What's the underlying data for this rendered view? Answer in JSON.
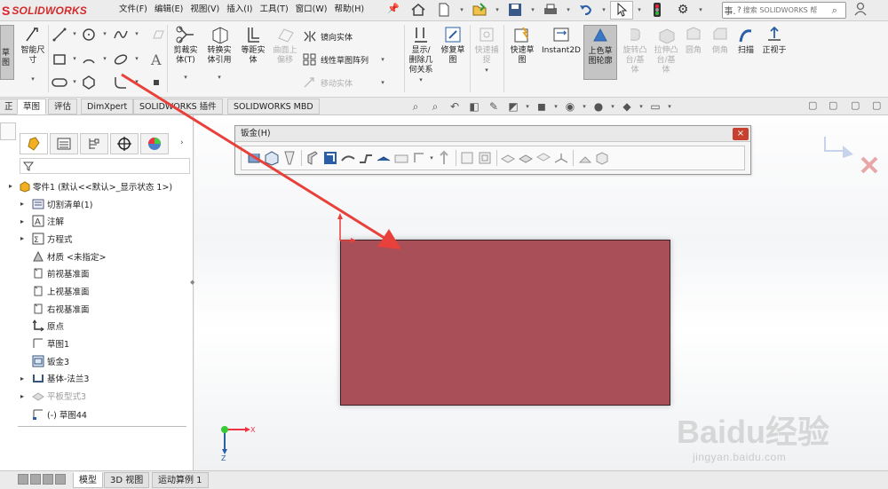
{
  "app": {
    "brand_mark": "S",
    "brand_name": "SOLIDWORKS"
  },
  "menu": [
    "文件(F)",
    "编辑(E)",
    "视图(V)",
    "插入(I)",
    "工具(T)",
    "窗口(W)",
    "帮助(H)"
  ],
  "quick_access": [
    "home-icon",
    "new-icon",
    "open-icon",
    "save-icon",
    "print-icon",
    "undo-icon",
    "select-icon",
    "traffic-light-icon",
    "options-icon"
  ],
  "search": {
    "prefix": "事.",
    "placeholder": "搜索 SOLIDWORKS 帮"
  },
  "command_manager": {
    "big_buttons": [
      {
        "label": "智能尺\n寸",
        "enabled": true
      },
      {
        "label": "剪裁实\n体(T)",
        "enabled": true
      },
      {
        "label": "转换实\n体引用",
        "enabled": true
      },
      {
        "label": "等距实\n体",
        "enabled": true
      },
      {
        "label": "曲面上\n偏移",
        "enabled": false
      },
      {
        "label": "显示/\n删除几\n何关系",
        "enabled": true
      },
      {
        "label": "修复草\n图",
        "enabled": true
      },
      {
        "label": "快速捕\n捉",
        "enabled": false
      },
      {
        "label": "快速草\n图",
        "enabled": true
      },
      {
        "label": "Instant2D",
        "enabled": true
      },
      {
        "label": "上色草\n图轮廓",
        "enabled": true,
        "active": true
      },
      {
        "label": "旋转凸\n台/基\n体",
        "enabled": false
      },
      {
        "label": "拉伸凸\n台/基\n体",
        "enabled": false
      },
      {
        "label": "圆角",
        "enabled": false
      },
      {
        "label": "倒角",
        "enabled": false
      },
      {
        "label": "扫描",
        "enabled": true
      },
      {
        "label": "正视于",
        "enabled": true
      }
    ],
    "small_buttons": [
      {
        "label": "镜向实体",
        "enabled": true
      },
      {
        "label": "线性草图阵列",
        "enabled": true
      },
      {
        "label": "移动实体",
        "enabled": false
      }
    ],
    "partial_left_label": "草\n图"
  },
  "tabs": [
    {
      "label": "正",
      "active": false
    },
    {
      "label": "草图",
      "active": true
    },
    {
      "label": "评估",
      "active": false
    },
    {
      "label": "DimXpert",
      "active": false
    },
    {
      "label": "SOLIDWORKS 插件",
      "active": false
    },
    {
      "label": "SOLIDWORKS MBD",
      "active": false
    }
  ],
  "feature_tree": [
    {
      "label": "零件1 (默认<<默认>_显示状态 1>)",
      "icon": "part-icon",
      "expand": "▸",
      "root": true
    },
    {
      "label": "切割清单(1)",
      "icon": "cut-list-icon",
      "expand": "▸"
    },
    {
      "label": "注解",
      "icon": "annotations-icon",
      "expand": "▸"
    },
    {
      "label": "方程式",
      "icon": "equations-icon",
      "expand": "▸"
    },
    {
      "label": "材质 <未指定>",
      "icon": "material-icon",
      "expand": ""
    },
    {
      "label": "前视基准面",
      "icon": "plane-icon",
      "expand": ""
    },
    {
      "label": "上视基准面",
      "icon": "plane-icon",
      "expand": ""
    },
    {
      "label": "右视基准面",
      "icon": "plane-icon",
      "expand": ""
    },
    {
      "label": "原点",
      "icon": "origin-icon",
      "expand": ""
    },
    {
      "label": "草图1",
      "icon": "sketch-icon",
      "expand": ""
    },
    {
      "label": "钣金3",
      "icon": "sheetmetal-icon",
      "expand": ""
    },
    {
      "label": "基体-法兰3",
      "icon": "base-flange-icon",
      "expand": "▸"
    },
    {
      "label": "平板型式3",
      "icon": "flat-pattern-icon",
      "expand": "▸",
      "disabled": true
    },
    {
      "label": "(-) 草图44",
      "icon": "sketch-icon",
      "expand": "",
      "highlighted": true
    }
  ],
  "sheet_metal_toolbar": {
    "title": "钣金(H)",
    "close": "×"
  },
  "bottom_tabs": [
    {
      "label": "模型",
      "active": true
    },
    {
      "label": "3D 视图",
      "active": false
    },
    {
      "label": "运动算例 1",
      "active": false
    }
  ],
  "triad": {
    "x": "X",
    "z": "Z"
  },
  "watermark": {
    "main": "Baidu经验",
    "sub": "jingyan.baidu.com"
  },
  "colors": {
    "plate": "#a84f58",
    "arrow": "#e8403a",
    "brand": "#d42a2a"
  }
}
